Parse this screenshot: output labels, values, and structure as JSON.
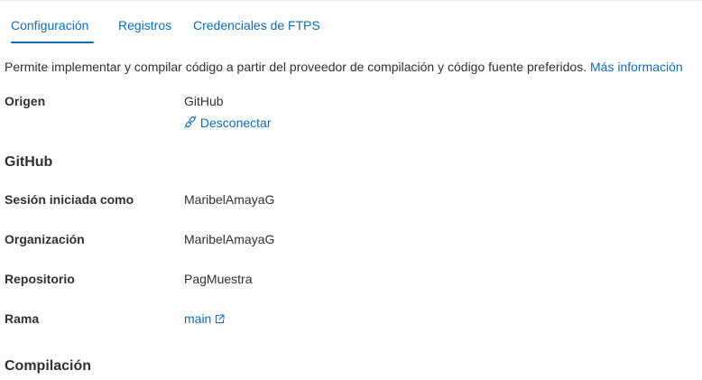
{
  "tabs": [
    {
      "label": "Configuración",
      "active": true
    },
    {
      "label": "Registros",
      "active": false
    },
    {
      "label": "Credenciales de FTPS",
      "active": false
    }
  ],
  "description": {
    "text": "Permite implementar y compilar código a partir del proveedor de compilación y código fuente preferidos.",
    "link": "Más información"
  },
  "source": {
    "label": "Origen",
    "value": "GitHub",
    "disconnect_label": "Desconectar",
    "disconnect_icon": "plug-disconnect-icon"
  },
  "github": {
    "heading": "GitHub",
    "signed_in_label": "Sesión iniciada como",
    "signed_in_value": "MaribelAmayaG",
    "org_label": "Organización",
    "org_value": "MaribelAmayaG",
    "repo_label": "Repositorio",
    "repo_value": "PagMuestra",
    "branch_label": "Rama",
    "branch_value": "main",
    "branch_icon": "open-external-icon"
  },
  "build": {
    "heading": "Compilación"
  },
  "colors": {
    "accent": "#0f6cbd",
    "text": "#323130",
    "divider": "#edebe9"
  }
}
